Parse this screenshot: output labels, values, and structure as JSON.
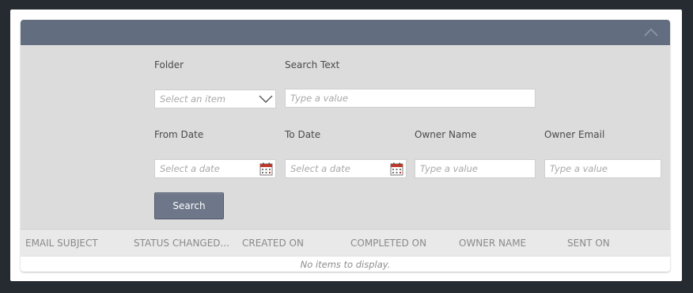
{
  "filters": {
    "folder": {
      "label": "Folder",
      "placeholder": "Select an item"
    },
    "search_text": {
      "label": "Search Text",
      "placeholder": "Type a value"
    },
    "from_date": {
      "label": "From Date",
      "placeholder": "Select a date"
    },
    "to_date": {
      "label": "To Date",
      "placeholder": "Select a date"
    },
    "owner_name": {
      "label": "Owner Name",
      "placeholder": "Type a value"
    },
    "owner_email": {
      "label": "Owner Email",
      "placeholder": "Type a value"
    },
    "search_button": "Search"
  },
  "grid": {
    "columns": [
      "EMAIL SUBJECT",
      "STATUS CHANGED...",
      "CREATED ON",
      "COMPLETED ON",
      "OWNER NAME",
      "SENT ON"
    ],
    "empty_message": "No items to display."
  },
  "icons": {
    "collapse": "chevron-up-icon",
    "dropdown": "chevron-down-icon",
    "calendar": "calendar-icon"
  },
  "colors": {
    "header": "#626e80",
    "panel": "#dcdcdc",
    "button": "#6d7789",
    "calendar_accent": "#c0392b"
  }
}
